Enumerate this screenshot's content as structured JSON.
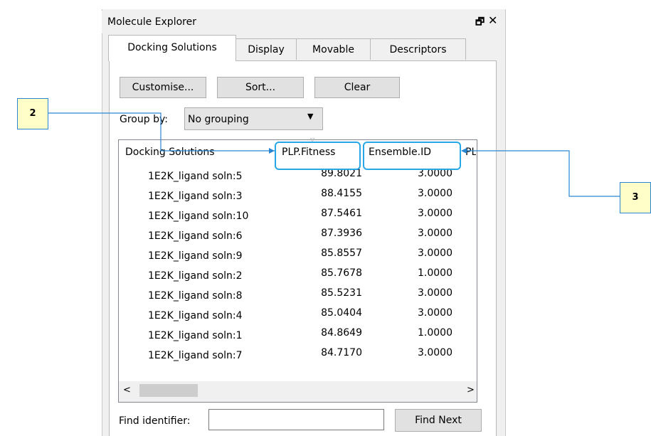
{
  "window": {
    "title": "Molecule Explorer",
    "float_glyph": "🗗",
    "close_glyph": "✕"
  },
  "tabs": [
    {
      "label": "Docking Solutions",
      "active": true
    },
    {
      "label": "Display"
    },
    {
      "label": "Movable"
    },
    {
      "label": "Descriptors"
    }
  ],
  "toolbar": {
    "customise": "Customise...",
    "sort": "Sort...",
    "clear": "Clear"
  },
  "group_by": {
    "label": "Group by:",
    "value": "No grouping",
    "arrow": "▼"
  },
  "table": {
    "headers": {
      "name": "Docking Solutions",
      "fitness": "PLP.Fitness",
      "ensemble": "Ensemble.ID",
      "partial": "PLF"
    },
    "rows": [
      {
        "name": "1E2K_ligand soln:5",
        "fitness": "89.8021",
        "ensemble": "3.0000"
      },
      {
        "name": "1E2K_ligand soln:3",
        "fitness": "88.4155",
        "ensemble": "3.0000"
      },
      {
        "name": "1E2K_ligand soln:10",
        "fitness": "87.5461",
        "ensemble": "3.0000"
      },
      {
        "name": "1E2K_ligand soln:6",
        "fitness": "87.3936",
        "ensemble": "3.0000"
      },
      {
        "name": "1E2K_ligand soln:9",
        "fitness": "85.8557",
        "ensemble": "3.0000"
      },
      {
        "name": "1E2K_ligand soln:2",
        "fitness": "85.7678",
        "ensemble": "1.0000"
      },
      {
        "name": "1E2K_ligand soln:8",
        "fitness": "85.5231",
        "ensemble": "3.0000"
      },
      {
        "name": "1E2K_ligand soln:4",
        "fitness": "85.0404",
        "ensemble": "3.0000"
      },
      {
        "name": "1E2K_ligand soln:1",
        "fitness": "84.8649",
        "ensemble": "1.0000"
      },
      {
        "name": "1E2K_ligand soln:7",
        "fitness": "84.7170",
        "ensemble": "3.0000"
      }
    ]
  },
  "scrollbar": {
    "left_glyph": "<",
    "right_glyph": ">"
  },
  "find": {
    "label": "Find identifier:",
    "value": "",
    "button": "Find Next"
  },
  "callouts": [
    {
      "label": "2"
    },
    {
      "label": "3"
    }
  ],
  "colors": {
    "callout_fill": "#fffec8",
    "callout_border": "#2a86d0",
    "highlight": "#28a7e8"
  }
}
